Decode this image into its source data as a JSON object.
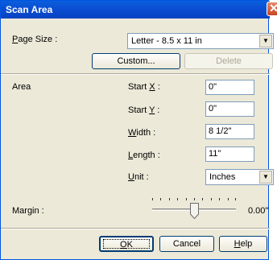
{
  "window": {
    "title": "Scan Area",
    "close": "✕"
  },
  "page_size": {
    "label_pre": "",
    "label_key": "P",
    "label_post": "age Size :",
    "value": "Letter - 8.5 x 11 in"
  },
  "buttons": {
    "custom": "Custom...",
    "delete": "Delete",
    "ok_key": "O",
    "ok_post": "K",
    "cancel": "Cancel",
    "help_key": "H",
    "help_post": "elp"
  },
  "area": {
    "label": "Area",
    "start_x": {
      "pre": "Start ",
      "key": "X",
      "post": " :",
      "value": "0\""
    },
    "start_y": {
      "pre": "Start ",
      "key": "Y",
      "post": " :",
      "value": "0\""
    },
    "width": {
      "key": "W",
      "post": "idth :",
      "value": "8 1/2\""
    },
    "length": {
      "key": "L",
      "post": "ength :",
      "value": "11\""
    },
    "unit": {
      "key": "U",
      "post": "nit :",
      "value": "Inches"
    }
  },
  "margin": {
    "label_pre": "Margin",
    "label_post": " :",
    "value": "0.00\"",
    "slider_fraction": 0.5
  }
}
